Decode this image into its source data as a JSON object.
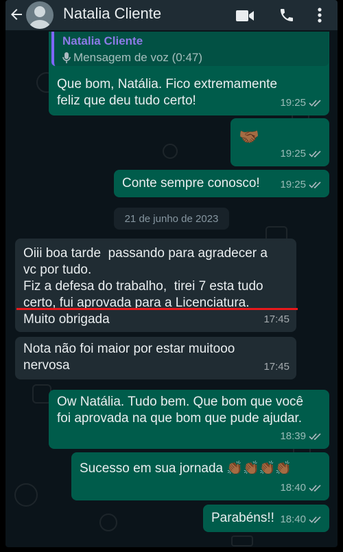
{
  "header": {
    "contact_name": "Natalia Cliente"
  },
  "messages": [
    {
      "quote_name": "Natalia Cliente",
      "quote_text": "Mensagem de voz (0:47)",
      "text": "Que bom, Natália. Fico extremamente\nfeliz que deu tudo certo!",
      "time": "19:25"
    },
    {
      "text": "🤝🏾",
      "time": "19:25"
    },
    {
      "text": "Conte sempre conosco!",
      "time": "19:25"
    },
    {
      "text": "Oiii boa tarde  passando para agradecer a\nvc por tudo.\nFiz a defesa do trabalho,  tirei 7 esta tudo\ncerto, fui aprovada para a Licenciatura.\nMuito obrigada",
      "time": "17:45"
    },
    {
      "text": "Nota não foi maior por estar muitooo\nnervosa",
      "time": "17:45"
    },
    {
      "text": "Ow Natália. Tudo bem. Que bom que você\nfoi aprovada na que bom que pude ajudar.",
      "time": "18:39"
    },
    {
      "text": "Sucesso em sua jornada 👏🏾👏🏾👏🏾👏🏾",
      "time": "18:40"
    },
    {
      "text": "Parabéns!!",
      "time": "18:40"
    }
  ],
  "date_chip": "21 de junho de 2023",
  "colors": {
    "header": "#1f2c34",
    "outgoing": "#005c4b",
    "incoming": "#202c33",
    "background": "#0b141a",
    "underline": "#e8191c"
  },
  "icons": [
    "back-arrow-icon",
    "avatar-icon",
    "video-call-icon",
    "phone-icon",
    "more-options-icon",
    "microphone-icon",
    "double-check-icon"
  ]
}
